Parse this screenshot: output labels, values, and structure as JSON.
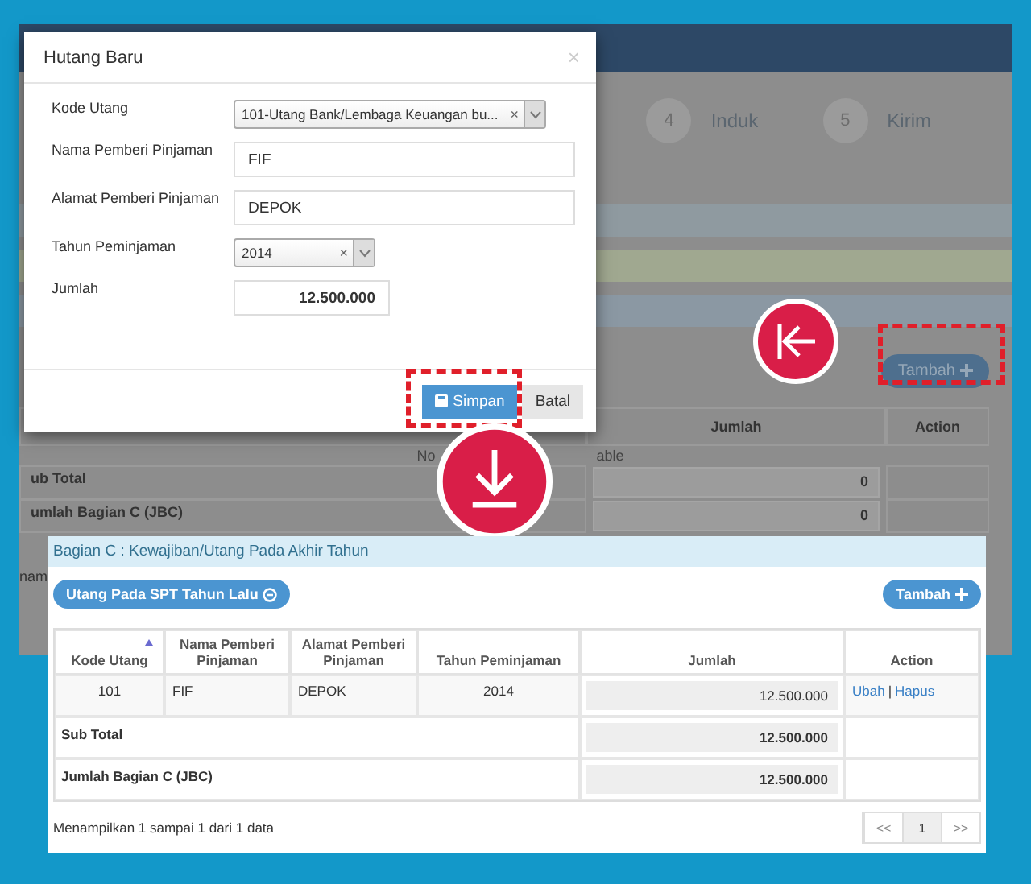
{
  "background_app": {
    "steps": [
      {
        "number": "4",
        "label": "Induk"
      },
      {
        "number": "5",
        "label": "Kirim"
      }
    ],
    "add_button": "Tambah",
    "table": {
      "columns": [
        "Jumlah",
        "Action"
      ],
      "empty_fragments": [
        "No",
        "able"
      ],
      "rows": [
        {
          "label": "ub Total",
          "value": "0"
        },
        {
          "label": "umlah Bagian C (JBC)",
          "value": "0"
        }
      ]
    },
    "footer_fragment": "nam"
  },
  "dialog": {
    "title": "Hutang Baru",
    "close": "×",
    "fields": [
      {
        "kind": "select",
        "label": "Kode Utang",
        "value": "101-Utang Bank/Lembaga Keuangan bu...",
        "clear": "×"
      },
      {
        "kind": "input",
        "label": "Nama Pemberi Pinjaman",
        "value": "FIF"
      },
      {
        "kind": "input",
        "label": "Alamat Pemberi Pinjaman",
        "value": "DEPOK"
      },
      {
        "kind": "select",
        "label": "Tahun Peminjaman",
        "value": "2014",
        "clear": "×"
      },
      {
        "kind": "number",
        "label": "Jumlah",
        "value": "12.500.000"
      }
    ],
    "buttons": [
      {
        "label": "Simpan",
        "primary": true
      },
      {
        "label": "Batal",
        "primary": false
      }
    ]
  },
  "result_panel": {
    "title": "Bagian C : Kewajiban/Utang Pada Akhir Tahun",
    "prev_year_button": "Utang Pada SPT Tahun Lalu",
    "add_button": "Tambah",
    "table": {
      "columns": [
        "Kode Utang",
        "Nama Pemberi Pinjaman",
        "Alamat Pemberi Pinjaman",
        "Tahun Peminjaman",
        "Jumlah",
        "Action"
      ],
      "rows": [
        {
          "cells": [
            "101",
            "FIF",
            "DEPOK",
            "2014",
            "12.500.000"
          ],
          "actions": [
            "Ubah",
            "Hapus"
          ],
          "separator": "|"
        }
      ],
      "summary": [
        {
          "label": "Sub Total",
          "value": "12.500.000"
        },
        {
          "label": "Jumlah Bagian C (JBC)",
          "value": "12.500.000"
        }
      ]
    },
    "footer": "Menampilkan 1 sampai 1 dari 1 data",
    "pagination": [
      {
        "label": "<<",
        "selected": false
      },
      {
        "label": "1",
        "selected": true
      },
      {
        "label": ">>",
        "selected": false
      }
    ]
  }
}
